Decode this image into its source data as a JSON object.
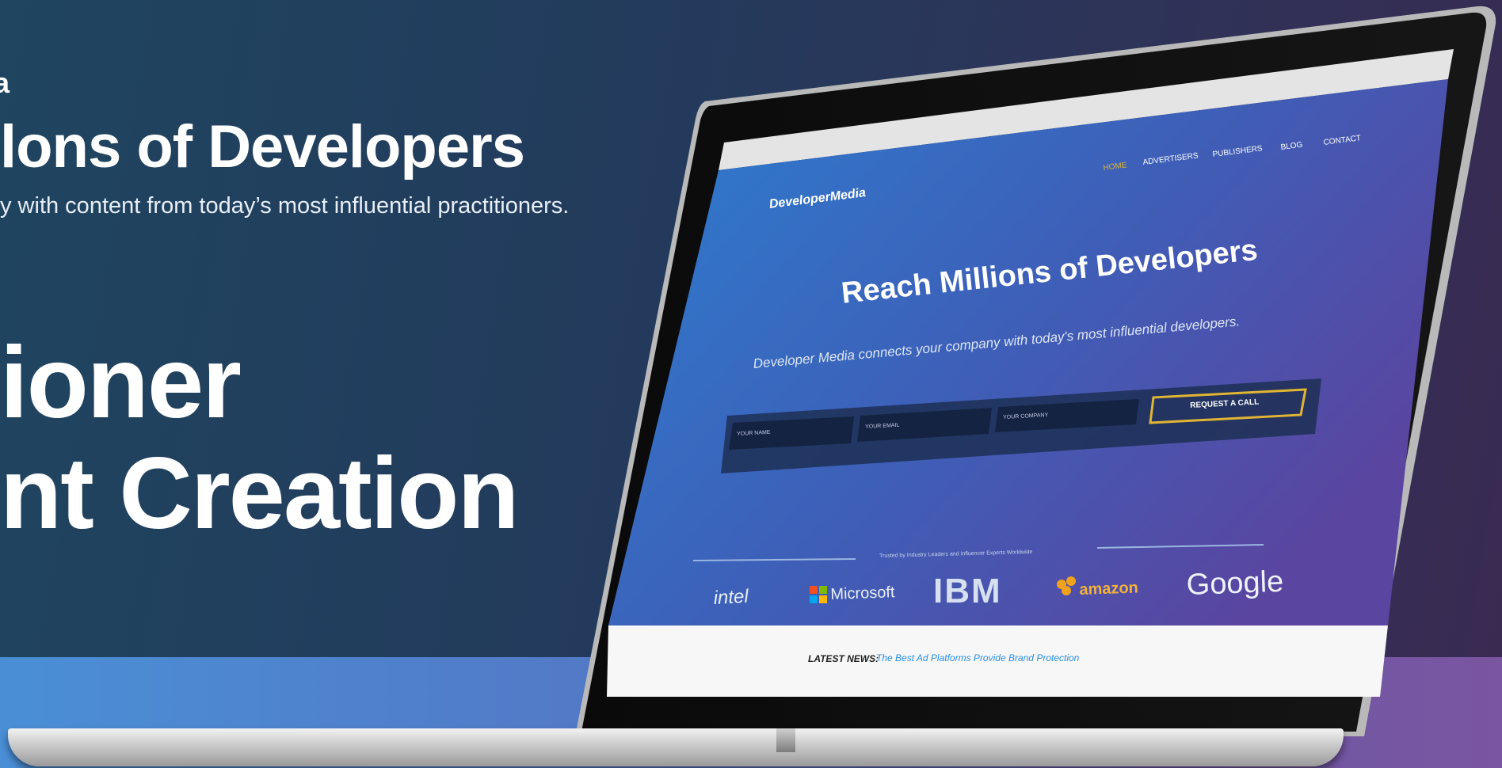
{
  "hero": {
    "eyebrow": "a",
    "title": "lons of Developers",
    "subtitle": "y with content from today’s most influential practitioners.",
    "big_line_1": "ioner",
    "big_line_2": "nt Creation"
  },
  "screen": {
    "logo": "DeveloperMedia",
    "nav": [
      "HOME",
      "ADVERTISERS",
      "PUBLISHERS",
      "BLOG",
      "CONTACT"
    ],
    "headline": "Reach Millions of Developers",
    "tagline": "Developer Media connects your company with today's most influential developers.",
    "fields": [
      "YOUR NAME",
      "YOUR EMAIL",
      "YOUR COMPANY"
    ],
    "cta": "REQUEST A CALL",
    "trusted": "Trusted by Industry Leaders and Influencer Experts Worldwide",
    "partners": [
      "intel",
      "Microsoft",
      "IBM",
      "amazon",
      "Google"
    ],
    "news_label": "LATEST NEWS:",
    "news_link": "The Best Ad Platforms Provide Brand Protection"
  },
  "colors": {
    "accent_gold": "#e0b533",
    "link_blue": "#2a8fe0"
  }
}
